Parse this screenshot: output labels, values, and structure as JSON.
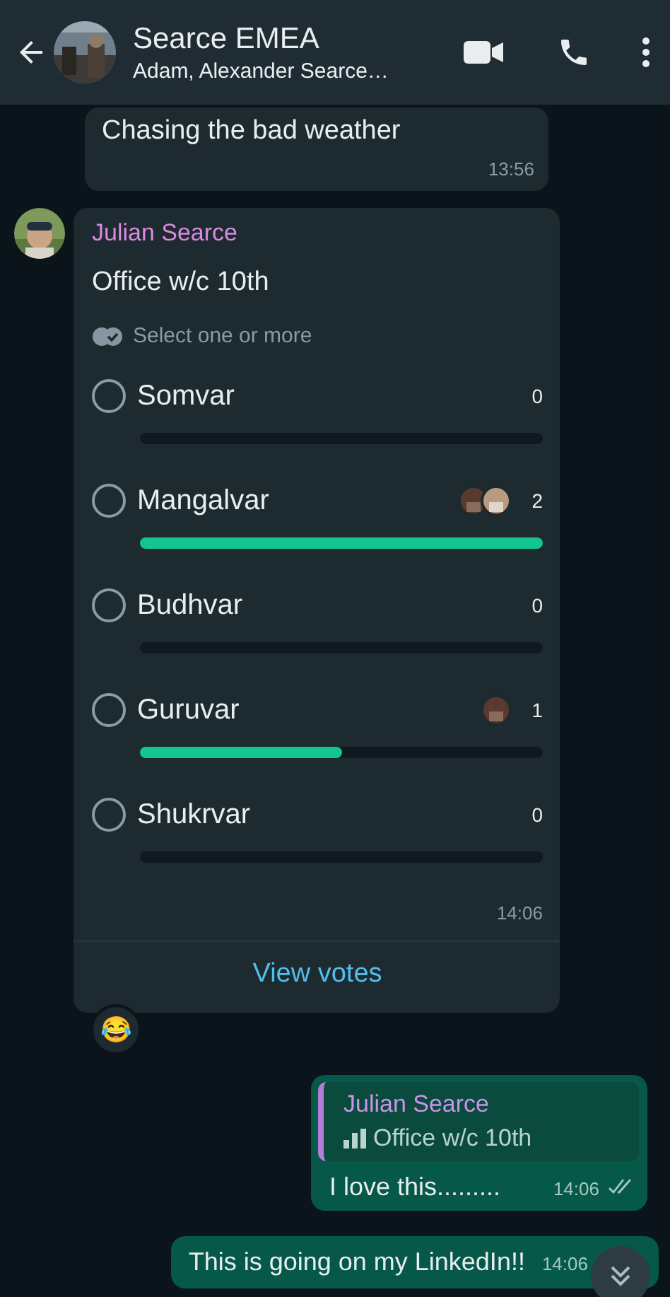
{
  "header": {
    "title": "Searce EMEA",
    "subtitle": "Adam, Alexander Searce…"
  },
  "messages": [
    {
      "kind": "incoming",
      "text": "Chasing the bad weather",
      "time": "13:56"
    },
    {
      "kind": "poll",
      "sender": "Julian Searce",
      "question": "Office w/c 10th",
      "hint": "Select one or more",
      "options": [
        {
          "label": "Somvar",
          "checked": false,
          "count": "0"
        },
        {
          "label": "Mangalvar",
          "checked": false,
          "count": "2",
          "voters": [
            {
              "kind": "picture"
            },
            {
              "kind": "picture"
            }
          ],
          "level": 1
        },
        {
          "label": "Budhvar",
          "checked": false,
          "count": "0"
        },
        {
          "label": "Guruvar",
          "checked": false,
          "count": "1",
          "voters": [
            {
              "kind": "picture"
            }
          ],
          "level": 0.5
        },
        {
          "label": "Shukrvar",
          "checked": false,
          "count": "0"
        }
      ],
      "time": "14:06",
      "action": "View votes",
      "reaction": "😂"
    },
    {
      "kind": "reply",
      "quote_sender": "Julian Searce",
      "quote_text": "Office w/c 10th",
      "text": "I love this.........",
      "time": "14:06"
    },
    {
      "kind": "outgoing",
      "text": "This is going on my LinkedIn!!",
      "time": "14:06"
    }
  ]
}
